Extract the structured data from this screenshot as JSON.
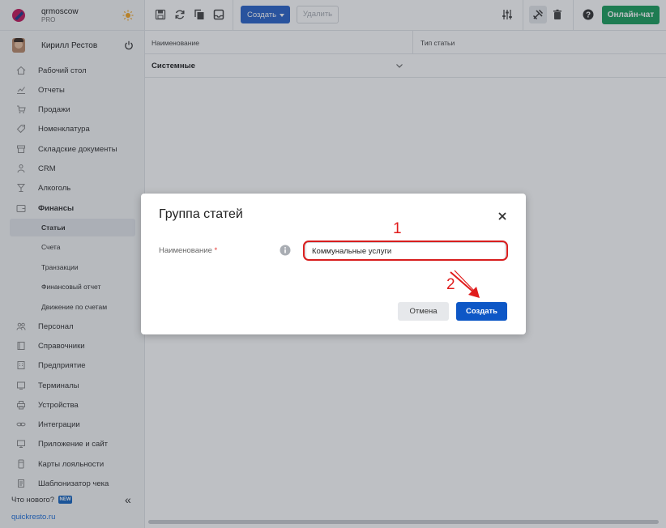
{
  "brand": {
    "name": "qrmoscow",
    "plan": "PRO"
  },
  "user": {
    "name": "Кирилл Рестов"
  },
  "sidebar": {
    "items": [
      {
        "label": "Рабочий стол",
        "icon": "home-icon"
      },
      {
        "label": "Отчеты",
        "icon": "chart-icon"
      },
      {
        "label": "Продажи",
        "icon": "cart-icon"
      },
      {
        "label": "Номенклатура",
        "icon": "tag-icon"
      },
      {
        "label": "Складские документы",
        "icon": "box-icon"
      },
      {
        "label": "CRM",
        "icon": "people-icon"
      },
      {
        "label": "Алкоголь",
        "icon": "glass-icon"
      },
      {
        "label": "Финансы",
        "icon": "wallet-icon"
      }
    ],
    "finance_sub": [
      {
        "label": "Статьи"
      },
      {
        "label": "Счета"
      },
      {
        "label": "Транзакции"
      },
      {
        "label": "Финансовый отчет"
      },
      {
        "label": "Движение по счетам"
      }
    ],
    "items_after": [
      {
        "label": "Персонал",
        "icon": "staff-icon"
      },
      {
        "label": "Справочники",
        "icon": "book-icon"
      },
      {
        "label": "Предприятие",
        "icon": "building-icon"
      },
      {
        "label": "Терминалы",
        "icon": "terminal-icon"
      },
      {
        "label": "Устройства",
        "icon": "printer-icon"
      },
      {
        "label": "Интеграции",
        "icon": "link-icon"
      },
      {
        "label": "Приложение и сайт",
        "icon": "monitor-icon"
      },
      {
        "label": "Карты лояльности",
        "icon": "card-icon"
      },
      {
        "label": "Шаблонизатор чека",
        "icon": "receipt-icon"
      }
    ],
    "whats_new": "Что нового?",
    "new_badge": "NEW",
    "site_link": "quickresto.ru"
  },
  "toolbar": {
    "create_label": "Создать",
    "delete_label": "Удалить",
    "chat_label": "Онлайн-чат"
  },
  "table": {
    "columns": [
      "Наименование",
      "Тип статьи"
    ],
    "rows": [
      {
        "name": "Системные"
      }
    ]
  },
  "modal": {
    "title": "Группа статей",
    "field_label": "Наименование",
    "required_mark": "*",
    "field_value": "Коммунальные услуги",
    "cancel_label": "Отмена",
    "submit_label": "Создать"
  },
  "annotations": {
    "step1": "1",
    "step2": "2"
  },
  "colors": {
    "accent": "#0d57c6",
    "chat": "#1a9e5c",
    "annotation": "#e01b1b"
  }
}
